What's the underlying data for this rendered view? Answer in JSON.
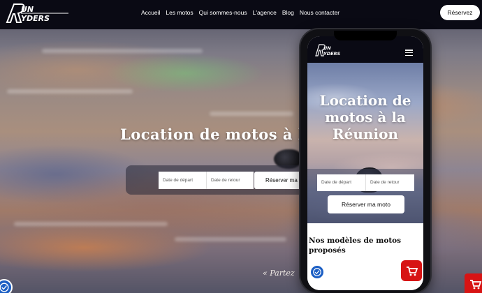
{
  "site": {
    "logo_text_line1": "UN",
    "logo_text_line2": "YDERS",
    "logo_initial": "R"
  },
  "nav": {
    "items": [
      {
        "label": "Accueil"
      },
      {
        "label": "Les motos"
      },
      {
        "label": "Qui sommes-nous"
      },
      {
        "label": "L'agence"
      },
      {
        "label": "Blog"
      },
      {
        "label": "Nous contacter"
      }
    ],
    "reserve_label": "Réservez"
  },
  "hero": {
    "title": "Location de motos à la",
    "search": {
      "start_placeholder": "Date de départ",
      "end_placeholder": "Date de retour",
      "button_label": "Réserver ma m"
    },
    "tagline": "« Partez"
  },
  "mobile": {
    "title": "Location de motos à la Réunion",
    "search": {
      "start_placeholder": "Date de départ",
      "end_placeholder": "Date de retour",
      "button_label": "Réserver ma moto"
    },
    "section_title": "Nos modèles de motos proposés"
  },
  "colors": {
    "header_bg": "#0a0a14",
    "accessibility_blue": "#1c5fc4",
    "cart_red": "#d71414"
  },
  "icons": [
    "logo",
    "hamburger-menu-icon",
    "accessibility-icon",
    "shopping-cart-icon"
  ]
}
